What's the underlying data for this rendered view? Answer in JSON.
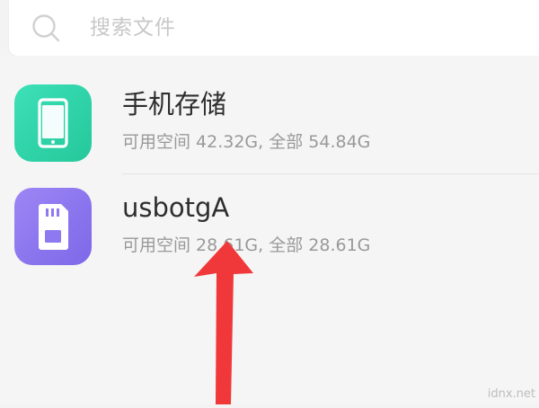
{
  "search": {
    "placeholder": "搜索文件",
    "icon": "search-icon"
  },
  "storage_items": [
    {
      "title": "手机存储",
      "subtitle": "可用空间 42.32G, 全部 54.84G",
      "icon": "phone-icon",
      "icon_color": "#2fd5a8"
    },
    {
      "title": "usbotgA",
      "subtitle": "可用空间 28.61G, 全部 28.61G",
      "icon": "sd-card-icon",
      "icon_color": "#8f79f0"
    }
  ],
  "annotation": {
    "arrow_color": "#f0383a"
  },
  "watermark": "idnx.net"
}
